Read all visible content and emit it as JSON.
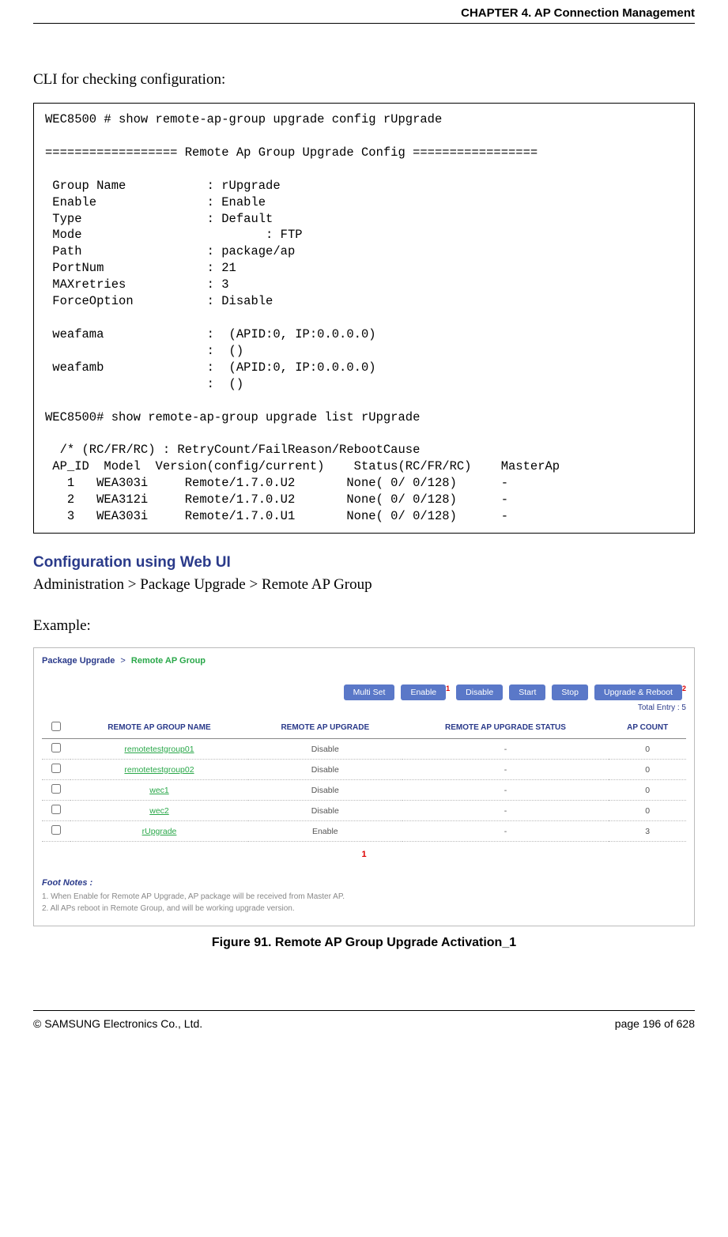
{
  "header": {
    "chapter": "CHAPTER 4. AP Connection Management"
  },
  "intro": "CLI for checking configuration:",
  "cli": "WEC8500 # show remote-ap-group upgrade config rUpgrade\n\n================== Remote Ap Group Upgrade Config =================\n\n Group Name           : rUpgrade\n Enable               : Enable\n Type                 : Default\n Mode                         : FTP\n Path                 : package/ap\n PortNum              : 21\n MAXretries           : 3\n ForceOption          : Disable\n\n weafama              :  (APID:0, IP:0.0.0.0)\n                      :  ()\n weafamb              :  (APID:0, IP:0.0.0.0)\n                      :  ()\n\nWEC8500# show remote-ap-group upgrade list rUpgrade\n\n  /* (RC/FR/RC) : RetryCount/FailReason/RebootCause\n AP_ID  Model  Version(config/current)    Status(RC/FR/RC)    MasterAp\n   1   WEA303i     Remote/1.7.0.U2       None( 0/ 0/128)      -\n   2   WEA312i     Remote/1.7.0.U2       None( 0/ 0/128)      -\n   3   WEA303i     Remote/1.7.0.U1       None( 0/ 0/128)      -",
  "web_section": {
    "title": "Configuration using Web UI",
    "nav": "Administration > Package Upgrade > Remote AP Group",
    "example_label": "Example:"
  },
  "webui": {
    "breadcrumb": {
      "parent": "Package Upgrade",
      "current": "Remote AP Group"
    },
    "buttons": {
      "multi_set": "Multi Set",
      "enable": "Enable",
      "disable": "Disable",
      "start": "Start",
      "stop": "Stop",
      "upgrade_reboot": "Upgrade & Reboot"
    },
    "annotations": {
      "a1": "1",
      "a2": "2",
      "center": "1"
    },
    "total_entry": "Total Entry : 5",
    "columns": {
      "name": "REMOTE AP GROUP NAME",
      "upgrade": "REMOTE AP UPGRADE",
      "status": "REMOTE AP UPGRADE STATUS",
      "count": "AP COUNT"
    },
    "rows": [
      {
        "name": "remotetestgroup01",
        "upgrade": "Disable",
        "status": "-",
        "count": "0"
      },
      {
        "name": "remotetestgroup02",
        "upgrade": "Disable",
        "status": "-",
        "count": "0"
      },
      {
        "name": "wec1",
        "upgrade": "Disable",
        "status": "-",
        "count": "0"
      },
      {
        "name": "wec2",
        "upgrade": "Disable",
        "status": "-",
        "count": "0"
      },
      {
        "name": "rUpgrade",
        "upgrade": "Enable",
        "status": "-",
        "count": "3"
      }
    ],
    "footnotes": {
      "heading": "Foot Notes :",
      "n1": "1. When Enable for Remote AP Upgrade, AP package will be received from Master AP.",
      "n2": "2. All APs reboot in Remote Group, and will be working upgrade version."
    }
  },
  "figure_caption": "Figure 91. Remote AP Group Upgrade Activation_1",
  "footer": {
    "copyright": "© SAMSUNG Electronics Co., Ltd.",
    "page": "page 196 of 628"
  }
}
